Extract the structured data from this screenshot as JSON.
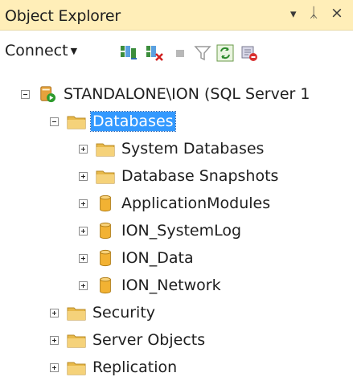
{
  "window": {
    "title": "Object Explorer",
    "pin_glyph": "▾",
    "pushpin_glyph": "ᛣ",
    "close_glyph": "×"
  },
  "toolbar": {
    "connect_label": "Connect",
    "icons": [
      "connect-object-explorer-icon",
      "disconnect-icon",
      "stop-icon",
      "filter-icon",
      "refresh-icon",
      "activity-monitor-icon"
    ]
  },
  "tree": {
    "server": {
      "label": "STANDALONE\\ION (SQL Server 1",
      "expanded": true
    },
    "databases": {
      "label": "Databases",
      "expanded": true,
      "selected": true
    },
    "database_children": [
      {
        "label": "System Databases",
        "icon": "folder-icon"
      },
      {
        "label": "Database Snapshots",
        "icon": "folder-icon"
      },
      {
        "label": "ApplicationModules",
        "icon": "database-icon"
      },
      {
        "label": "ION_SystemLog",
        "icon": "database-icon"
      },
      {
        "label": "ION_Data",
        "icon": "database-icon"
      },
      {
        "label": "ION_Network",
        "icon": "database-icon"
      }
    ],
    "server_children": [
      {
        "label": "Security",
        "icon": "folder-icon"
      },
      {
        "label": "Server Objects",
        "icon": "folder-icon"
      },
      {
        "label": "Replication",
        "icon": "folder-icon"
      }
    ]
  },
  "colors": {
    "titlebar_bg": "#ffeeb8",
    "selection_bg": "#3399ff",
    "folder": "#e8b94a",
    "database": "#f2b233"
  }
}
